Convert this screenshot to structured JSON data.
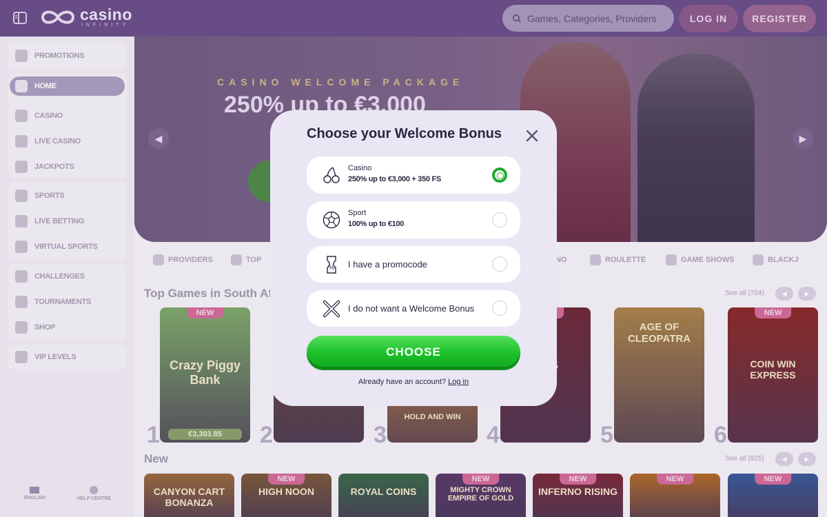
{
  "header": {
    "logo_main": "casino",
    "logo_sub": "INFINITY",
    "search_placeholder": "Games, Categories, Providers",
    "login_label": "LOG IN",
    "register_label": "REGISTER"
  },
  "sidebar": {
    "items": [
      {
        "label": "PROMOTIONS",
        "icon": "gift-icon"
      },
      {
        "label": "HOME",
        "icon": "home-icon",
        "active": true
      },
      {
        "label": "CASINO",
        "icon": "slot-icon"
      },
      {
        "label": "LIVE CASINO",
        "icon": "live-card-icon"
      },
      {
        "label": "JACKPOTS",
        "icon": "jackpot-icon"
      },
      {
        "label": "SPORTS",
        "icon": "football-icon"
      },
      {
        "label": "LIVE BETTING",
        "icon": "live-tv-icon"
      },
      {
        "label": "VIRTUAL SPORTS",
        "icon": "gamepad-icon"
      },
      {
        "label": "CHALLENGES",
        "icon": "challenge-icon"
      },
      {
        "label": "TOURNAMENTS",
        "icon": "trophy-icon"
      },
      {
        "label": "SHOP",
        "icon": "basket-icon"
      },
      {
        "label": "VIP LEVELS",
        "icon": "star-icon"
      }
    ],
    "language_label": "ENGLISH",
    "help_label": "HELP CENTRE"
  },
  "banner": {
    "eyebrow": "CASINO WELCOME PACKAGE",
    "headline": "250% up to €3,000"
  },
  "categories": [
    {
      "label": "PROVIDERS",
      "icon": "providers-icon"
    },
    {
      "label": "TOP",
      "icon": "crown-icon"
    },
    {
      "label": "NO",
      "icon": "tab-icon"
    },
    {
      "label": "ROULETTE",
      "icon": "roulette-icon"
    },
    {
      "label": "GAME SHOWS",
      "icon": "mic-icon"
    },
    {
      "label": "BLACKJ",
      "icon": "cards-icon"
    }
  ],
  "top_games": {
    "title": "Top Games in South Afri",
    "see_all": "See all (704)",
    "games": [
      {
        "rank": "1",
        "title": "Crazy Piggy Bank",
        "new": "NEW",
        "price": "€3,303.85",
        "color": "#7da86a"
      },
      {
        "rank": "2",
        "title": "",
        "new": "",
        "price": "",
        "color": "#6a4a3a"
      },
      {
        "rank": "3",
        "title": "HOLD AND WIN",
        "new": "",
        "price": "",
        "color": "#c88a3a"
      },
      {
        "rank": "4",
        "title": "ERS",
        "new": "NEW",
        "price": "",
        "color": "#6e2a3a"
      },
      {
        "rank": "5",
        "title": "AGE OF CLEOPATRA",
        "new": "",
        "price": "",
        "color": "#a8824a"
      },
      {
        "rank": "6",
        "title": "COIN WIN EXPRESS",
        "new": "NEW",
        "price": "",
        "color": "#8a2a2a"
      }
    ]
  },
  "new_games": {
    "title": "New",
    "see_all": "See all (825)",
    "games": [
      {
        "title": "CANYON CART BONANZA",
        "new": "",
        "color": "#9a6a3e"
      },
      {
        "title": "HIGH NOON",
        "new": "NEW",
        "color": "#7a5a3a"
      },
      {
        "title": "ROYAL COINS",
        "new": "",
        "color": "#3a6a4a"
      },
      {
        "title": "MIGHTY CROWN EMPIRE OF GOLD",
        "new": "NEW",
        "color": "#5a3a6a"
      },
      {
        "title": "INFERNO RISING",
        "new": "NEW",
        "color": "#7a2a3a"
      },
      {
        "title": "",
        "new": "NEW",
        "color": "#b06a2a"
      },
      {
        "title": "",
        "new": "NEW",
        "color": "#3a5a9a"
      }
    ]
  },
  "modal": {
    "title": "Choose your Welcome Bonus",
    "options": [
      {
        "category": "Casino",
        "detail": "250% up to €3,000 + 350 FS",
        "icon": "cherries-icon",
        "checked": true
      },
      {
        "category": "Sport",
        "detail": "100% up to €100",
        "icon": "soccer-ball-icon",
        "checked": false
      },
      {
        "label": "I have a promocode",
        "icon": "promocode-icon",
        "checked": false
      },
      {
        "label": "I do not want a Welcome Bonus",
        "icon": "no-bonus-icon",
        "checked": false
      }
    ],
    "choose_label": "CHOOSE",
    "footer_text": "Already have an account?",
    "login_link": "Log in"
  }
}
